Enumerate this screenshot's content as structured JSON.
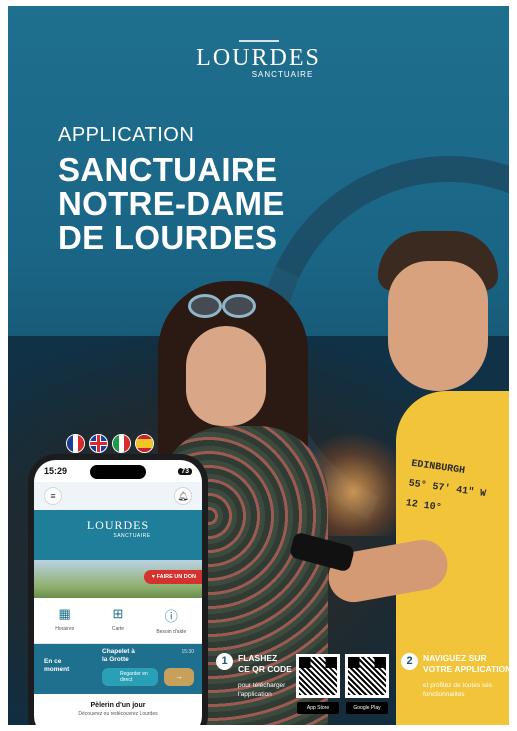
{
  "logo": {
    "main": "LOURDES",
    "sub": "SANCTUAIRE"
  },
  "headline": {
    "eyebrow": "APPLICATION",
    "title_lines": [
      "SANCTUAIRE",
      "NOTRE-DAME",
      "DE LOURDES"
    ]
  },
  "languages": [
    {
      "icon": "flag-france-icon",
      "colors": [
        "#1e3b96",
        "#ffffff",
        "#d92b2b"
      ]
    },
    {
      "icon": "flag-uk-icon",
      "colors": [
        "#1e3b96",
        "#ffffff",
        "#d92b2b"
      ]
    },
    {
      "icon": "flag-italy-icon",
      "colors": [
        "#1e9a4a",
        "#ffffff",
        "#d92b2b"
      ]
    },
    {
      "icon": "flag-spain-icon",
      "colors": [
        "#c6262b",
        "#f3c623",
        "#c6262b"
      ]
    }
  ],
  "tshirt_text": [
    "EDINBURGH",
    "55° 57' 41\" W 12 10°"
  ],
  "phone": {
    "time": "15:29",
    "battery": "73",
    "app_logo": {
      "main": "LOURDES",
      "sub": "SANCTUAIRE"
    },
    "donate_label": "FAIRE UN DON",
    "tiles": [
      {
        "icon": "calendar-icon",
        "label": "Horaires"
      },
      {
        "icon": "map-icon",
        "label": "Carte"
      },
      {
        "icon": "info-icon",
        "label": "Besoin d'aide"
      }
    ],
    "moment": {
      "label_lines": [
        "En ce",
        "moment"
      ],
      "place_lines": [
        "Chapelet à",
        "la Grotte"
      ],
      "time": "15:30",
      "button_text": "Regarder en direct",
      "arrow": "→"
    },
    "pelerin": {
      "title": "Pèlerin d'un jour",
      "description": "Découvrez ou redécouvrez Lourdes"
    }
  },
  "steps": [
    {
      "number": "1",
      "heading_lines": [
        "FLASHEZ",
        "CE QR CODE"
      ],
      "body": "pour télécharger l'application"
    },
    {
      "number": "2",
      "heading_lines": [
        "NAVIGUEZ SUR",
        "VOTRE APPLICATION"
      ],
      "body": "et profitez de toutes ses fonctionnalités"
    }
  ],
  "stores": {
    "apple": "App Store",
    "google": "Google Play"
  },
  "colors": {
    "brand": "#1f6f8f",
    "accent": "#d4322f",
    "shirt": "#f2c43a"
  }
}
